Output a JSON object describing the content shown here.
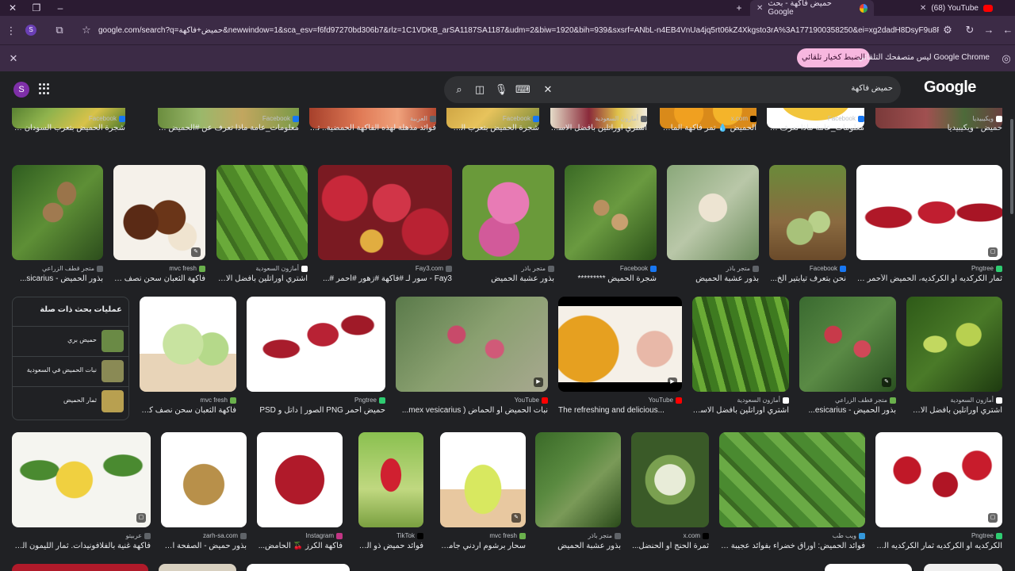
{
  "tabs": [
    {
      "title": "حميض فاكهة - بحث Google",
      "active": true
    },
    {
      "title": "(68) YouTube",
      "active": false
    }
  ],
  "address": {
    "url": "google.com/search?q=حميض+فاكهة&newwindow=1&sca_esv=f6fd97270bd306b7&rlz=1C1VDKB_arSA1187SA1187&udm=2&biw=1920&bih=939&sxsrf=ANbL-n4EB4VnUa4jq5rt06kZ4Xkgsto3rA%3A1771900358250&ei=xg2dadH8DsyF9u8PpK6w4AI&oq...",
    "profile_letter": "S"
  },
  "infobar": {
    "message": "Google Chrome ليس متصفحك التلقائي",
    "button": "الضبط كخيار تلقائي"
  },
  "google": {
    "logo": "Google",
    "query": "حميض فاكهة",
    "avatar_letter": "S"
  },
  "related": {
    "title": "عمليات بحث ذات صلة",
    "items": [
      {
        "label": "حميض بري",
        "color": "#6a8a45"
      },
      {
        "label": "نبات الحميض في السعودية",
        "color": "#8a8a55"
      },
      {
        "label": "ثمار الحميض",
        "color": "#b8a050"
      }
    ]
  },
  "row0": [
    {
      "src": "Facebook",
      "cap": "شجرة الحميض بتعرب السودان كردفان ووالايا..."
    },
    {
      "src": "Facebook",
      "cap": "معلومات_عامة ماذا تعرف عن #الحميض ؟ #ا..."
    },
    {
      "src": "العربية",
      "cap": "فوائد مذهلة لهذه الفاكهة الحمضية.. تعرّف..."
    },
    {
      "src": "Facebook",
      "cap": "شجرة الحميض بتعرب السودا..."
    },
    {
      "src": "أمازون السعودية",
      "cap": "اشتري اوراتلين بأفضل الاسعار..."
    },
    {
      "src": "x.com",
      "cap": "الحميض 💧 تمر فاكهة المارو..."
    },
    {
      "src": "Facebook",
      "cap": "معلومات_عامة ماذا تعرف عن..."
    },
    {
      "src": "ويكيبيديا",
      "cap": "حميض - ويكيبيديا"
    }
  ],
  "row1": [
    {
      "src": "متجر قطف الزراعي",
      "cap": "بذور الحميض - sicarius..."
    },
    {
      "src": "mvc fresh",
      "cap": "فاكهة الثعبان سحن نصف كيل..."
    },
    {
      "src": "أمازون السعودية",
      "cap": "اشتري اوراتلين بأفضل الاسعا..."
    },
    {
      "src": "Fay3.com",
      "cap": "Fay3 - سور لـ #فاكهة #زهور #أحمر #..."
    },
    {
      "src": "متجر باذر",
      "cap": "بذور عشبة الحميض"
    },
    {
      "src": "Facebook",
      "cap": "شجرة الحميض *********"
    },
    {
      "src": "متجر باذر",
      "cap": "بذور عشبة الحميض"
    },
    {
      "src": "Facebook",
      "cap": "نحن بتعرف تيابتير الخ..."
    },
    {
      "src": "Pngtree",
      "cap": "ثمار الكركديه أو الكركديه، الحميض الأحمر الأ..."
    }
  ],
  "row2": [
    {
      "src": "mvc fresh",
      "cap": "فاكهة الثعبان سحن نصف كيل..."
    },
    {
      "src": "Pngtree",
      "cap": "حميض أحمر PNG الصور | داتل و PSD"
    },
    {
      "src": "YouTube",
      "cap": "نبات الحميض أو الحماض ( mex vesicarius..."
    },
    {
      "src": "YouTube",
      "cap": "The refreshing and delicious..."
    },
    {
      "src": "أمازون السعودية",
      "cap": "اشتري اوراتلين بأفضل الاسعا..."
    },
    {
      "src": "متجر قطف الزراعي",
      "cap": "بذور الحميض - esicarius..."
    },
    {
      "src": "أمازون السعودية",
      "cap": "اشتري اوراتلين بأفضل الاسعا..."
    }
  ],
  "row3": [
    {
      "src": "عربيتو",
      "cap": "فاكهة غنية بالفلافونيدات. ثمار الليمون الحامض..."
    },
    {
      "src": "zarh-sa.com",
      "cap": "بذور حميض - الصفحة ال..."
    },
    {
      "src": "Instagram",
      "cap": "فاكهة الكرز 🍒 الحامض..."
    },
    {
      "src": "TikTok",
      "cap": "فوائد حميض ذو العرو..."
    },
    {
      "src": "mvc fresh",
      "cap": "سحار برشوم اردني جاموي..."
    },
    {
      "src": "متجر باذر",
      "cap": "بذور عشبة الحميض"
    },
    {
      "src": "x.com",
      "cap": "ثمرة الحنج أو الحنضل..."
    },
    {
      "src": "ويب طب",
      "cap": "فوائد الحميض: أوراق خضراء بفوائد عجيبة - ويب..."
    },
    {
      "src": "Pngtree",
      "cap": "الكركديه أو الكركديه ثمار الكركديه الحامض..."
    }
  ]
}
